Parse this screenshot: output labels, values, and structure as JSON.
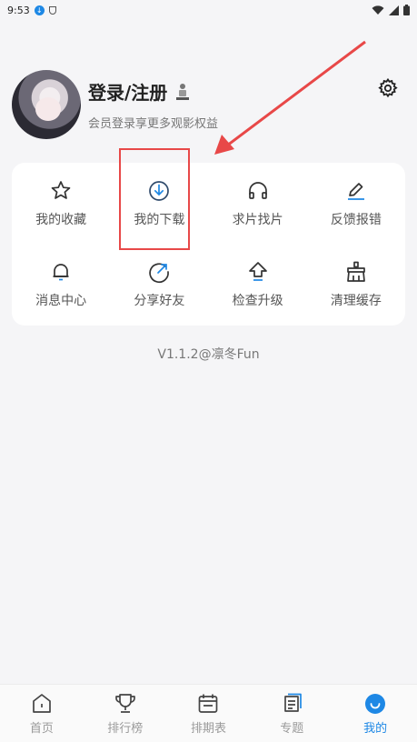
{
  "status_bar": {
    "time": "9:53",
    "notification_badge": "↓"
  },
  "profile": {
    "title": "登录/注册",
    "subtitle": "会员登录享更多观影权益"
  },
  "menu": {
    "row1": [
      {
        "label": "我的收藏",
        "icon": "star-icon"
      },
      {
        "label": "我的下载",
        "icon": "download-icon"
      },
      {
        "label": "求片找片",
        "icon": "headphones-icon"
      },
      {
        "label": "反馈报错",
        "icon": "edit-icon"
      }
    ],
    "row2": [
      {
        "label": "消息中心",
        "icon": "bell-icon"
      },
      {
        "label": "分享好友",
        "icon": "share-icon"
      },
      {
        "label": "检查升级",
        "icon": "upgrade-icon"
      },
      {
        "label": "清理缓存",
        "icon": "broom-icon"
      }
    ]
  },
  "version": "V1.1.2@凛冬Fun",
  "tabbar": {
    "tabs": [
      {
        "label": "首页",
        "icon": "home-icon"
      },
      {
        "label": "排行榜",
        "icon": "trophy-icon"
      },
      {
        "label": "排期表",
        "icon": "calendar-icon"
      },
      {
        "label": "专题",
        "icon": "topic-icon"
      },
      {
        "label": "我的",
        "icon": "profile-icon"
      }
    ],
    "active": "我的"
  },
  "colors": {
    "accent": "#1e88e5",
    "annotation": "#e84848"
  }
}
